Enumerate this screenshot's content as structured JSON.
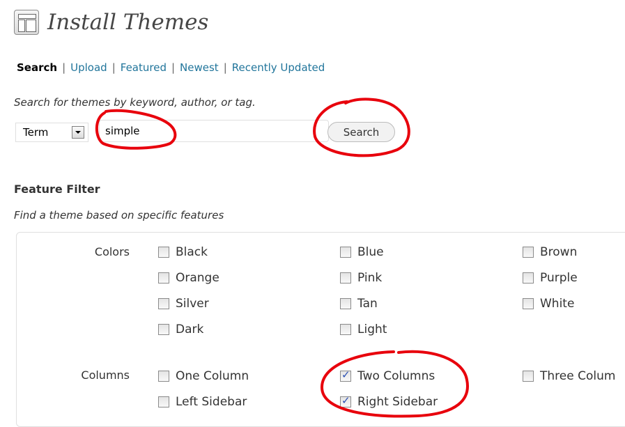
{
  "header": {
    "title": "Install Themes",
    "icon": "theme-layout-icon"
  },
  "nav": {
    "items": [
      {
        "label": "Search",
        "current": true
      },
      {
        "label": "Upload",
        "current": false
      },
      {
        "label": "Featured",
        "current": false
      },
      {
        "label": "Newest",
        "current": false
      },
      {
        "label": "Recently Updated",
        "current": false
      }
    ]
  },
  "search": {
    "description": "Search for themes by keyword, author, or tag.",
    "type_select": "Term",
    "value": "simple",
    "button_label": "Search"
  },
  "filter": {
    "title": "Feature Filter",
    "description": "Find a theme based on specific features",
    "groups": [
      {
        "label": "Colors",
        "options": [
          {
            "label": "Black",
            "checked": false
          },
          {
            "label": "Blue",
            "checked": false
          },
          {
            "label": "Brown",
            "checked": false
          },
          {
            "label": "Orange",
            "checked": false
          },
          {
            "label": "Pink",
            "checked": false
          },
          {
            "label": "Purple",
            "checked": false
          },
          {
            "label": "Silver",
            "checked": false
          },
          {
            "label": "Tan",
            "checked": false
          },
          {
            "label": "White",
            "checked": false
          },
          {
            "label": "Dark",
            "checked": false
          },
          {
            "label": "Light",
            "checked": false
          }
        ]
      },
      {
        "label": "Columns",
        "options": [
          {
            "label": "One Column",
            "checked": false
          },
          {
            "label": "Two Columns",
            "checked": true
          },
          {
            "label": "Three Colum",
            "checked": false
          },
          {
            "label": "Left Sidebar",
            "checked": false
          },
          {
            "label": "Right Sidebar",
            "checked": true
          }
        ]
      }
    ]
  },
  "colors": {
    "link": "#21759b",
    "annotation": "#e8000c",
    "check": "#2b4fb2"
  }
}
